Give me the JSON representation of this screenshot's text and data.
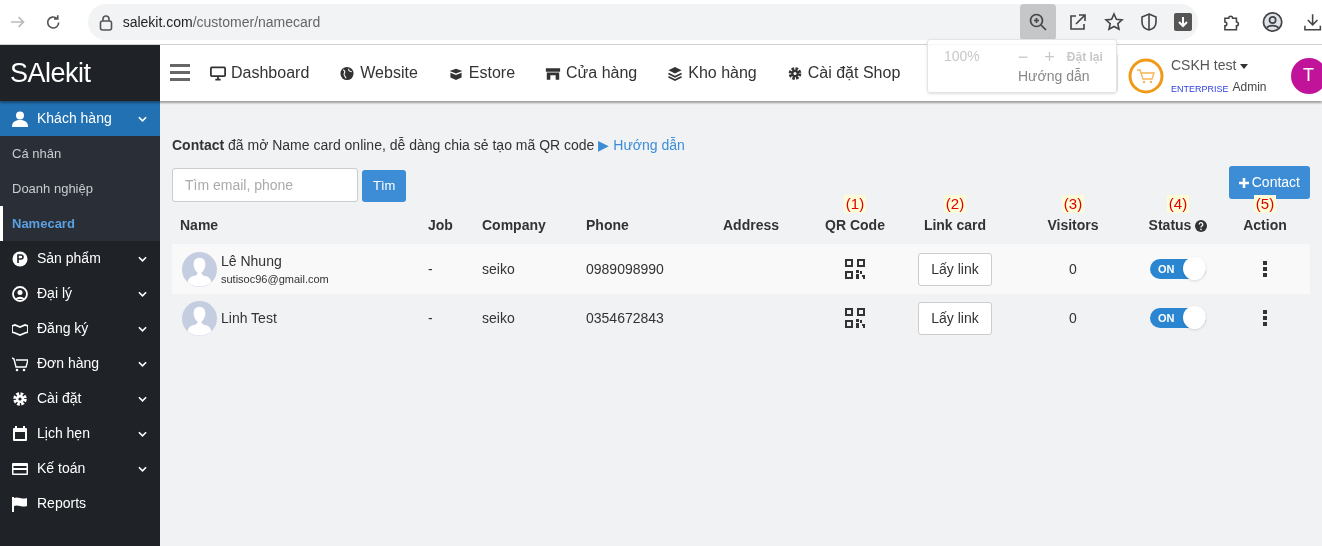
{
  "browser": {
    "url_domain": "salekit.com",
    "url_path": "/customer/namecard",
    "zoom_popup": {
      "level": "100%",
      "minus": "−",
      "plus": "+",
      "reset": "Đặt lại"
    }
  },
  "header": {
    "logo": "SAlekit",
    "nav": [
      "Dashboard",
      "Website",
      "Estore",
      "Cửa hàng",
      "Kho hàng",
      "Cài đặt Shop"
    ],
    "overlay_text": "Hướng dẫn",
    "user": {
      "name": "CSKH test",
      "plan": "ENTERPRISE",
      "role": "Admin",
      "avatar_letter": "T"
    }
  },
  "sidebar": {
    "items": [
      {
        "label": "Khách hàng",
        "has_submenu": true,
        "expanded": true,
        "children": [
          {
            "label": "Cá nhân",
            "selected": false
          },
          {
            "label": "Doanh nghiệp",
            "selected": false
          },
          {
            "label": "Namecard",
            "selected": true
          }
        ]
      },
      {
        "label": "Sản phẩm",
        "has_submenu": true,
        "expanded": false
      },
      {
        "label": "Đại lý",
        "has_submenu": true,
        "expanded": false
      },
      {
        "label": "Đăng ký",
        "has_submenu": true,
        "expanded": false
      },
      {
        "label": "Đơn hàng",
        "has_submenu": true,
        "expanded": false
      },
      {
        "label": "Cài đặt",
        "has_submenu": true,
        "expanded": false
      },
      {
        "label": "Lịch hẹn",
        "has_submenu": true,
        "expanded": false
      },
      {
        "label": "Kế toán",
        "has_submenu": true,
        "expanded": false
      },
      {
        "label": "Reports",
        "has_submenu": false,
        "expanded": false
      }
    ]
  },
  "intro": {
    "text": "**Contact** đã mở Name card online, dễ dàng chia sẻ tạo mã QR code",
    "link": "▶ Hướng dẫn"
  },
  "search": {
    "placeholder": "Tìm email, phone",
    "button": "Tìm"
  },
  "add_button": "Contact",
  "table": {
    "columns": [
      {
        "label": "Name"
      },
      {
        "label": "Job"
      },
      {
        "label": "Company"
      },
      {
        "label": "Phone"
      },
      {
        "label": "Address"
      },
      {
        "label": "QR Code",
        "annotation": "(1)"
      },
      {
        "label": "Link card",
        "annotation": "(2)"
      },
      {
        "label": "Visitors",
        "annotation": "(3)"
      },
      {
        "label": "Status",
        "annotation": "(4)"
      },
      {
        "label": "Action",
        "annotation": "(5)"
      }
    ],
    "rows": [
      {
        "name": "Lê Nhung",
        "email": "sutisoc96@gmail.com",
        "job": "-",
        "company": "seiko",
        "phone": "0989098990",
        "link_button": "Lấy link",
        "visitors": "0",
        "status_on": true,
        "status_label": "ON"
      },
      {
        "name": "Linh Test",
        "job": "-",
        "company": "seiko",
        "phone": "0354672843",
        "link_button": "Lấy link",
        "visitors": "0",
        "status_on": true,
        "status_label": "ON"
      }
    ]
  }
}
